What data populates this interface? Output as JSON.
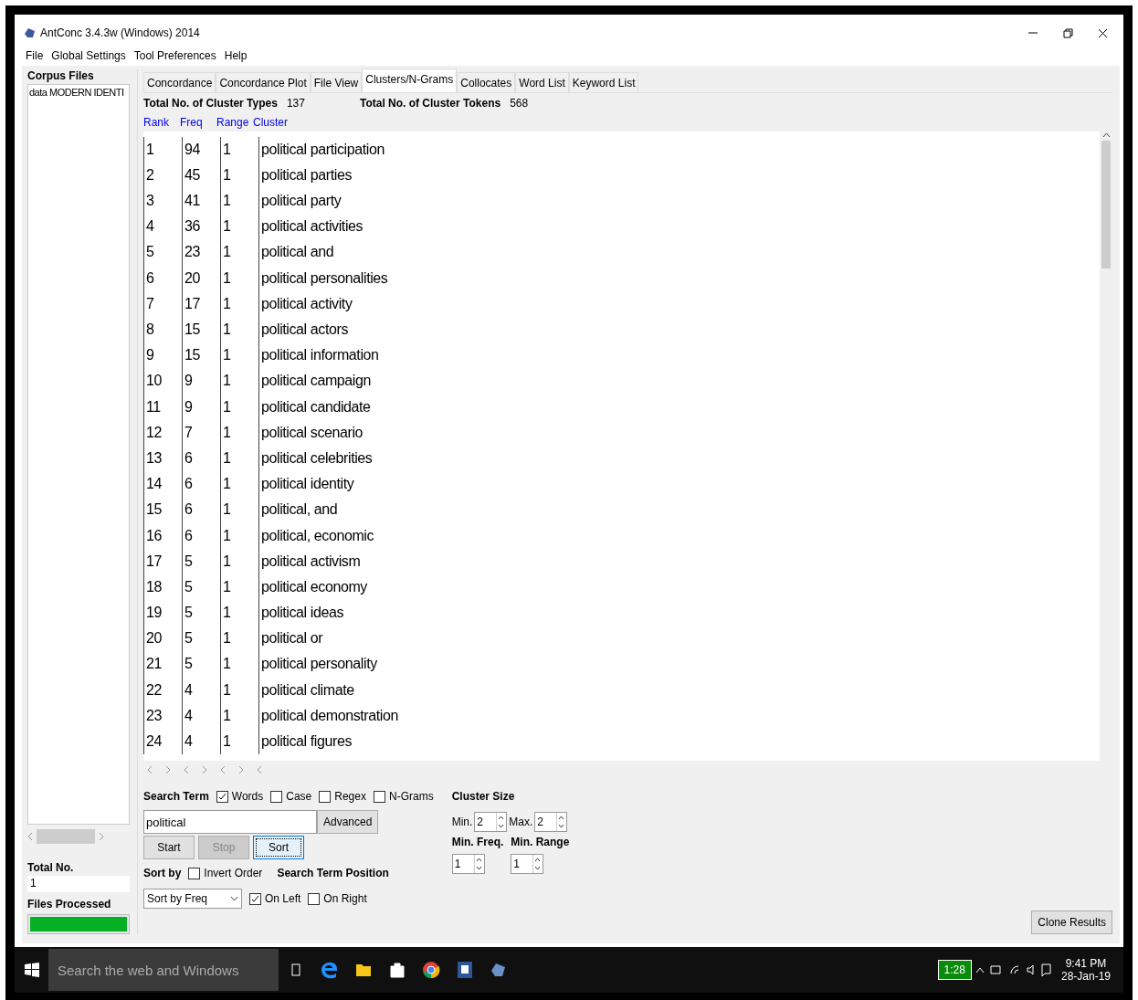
{
  "window": {
    "title": "AntConc 3.4.3w (Windows) 2014"
  },
  "menu": [
    "File",
    "Global Settings",
    "Tool Preferences",
    "Help"
  ],
  "sidebar": {
    "heading": "Corpus Files",
    "files": [
      "data MODERN IDENTI"
    ],
    "total_label": "Total No.",
    "total_value": "1",
    "processed_label": "Files Processed",
    "progress": {
      "level": 1
    }
  },
  "tabs": [
    {
      "label": "Concordance",
      "selected": false
    },
    {
      "label": "Concordance Plot",
      "selected": false
    },
    {
      "label": "File View",
      "selected": false
    },
    {
      "label": "Clusters/N-Grams",
      "selected": true
    },
    {
      "label": "Collocates",
      "selected": false
    },
    {
      "label": "Word List",
      "selected": false
    },
    {
      "label": "Keyword List",
      "selected": false
    }
  ],
  "totals": [
    {
      "label": "Total No. of Cluster Types",
      "value": "137"
    },
    {
      "label": "Total No. of Cluster Tokens",
      "value": "568"
    }
  ],
  "table": {
    "columns": [
      "Rank",
      "Freq",
      "Range",
      "Cluster"
    ],
    "rows": [
      [
        "1",
        "94",
        "1",
        "political participation"
      ],
      [
        "2",
        "45",
        "1",
        "political parties"
      ],
      [
        "3",
        "41",
        "1",
        "political party"
      ],
      [
        "4",
        "36",
        "1",
        "political activities"
      ],
      [
        "5",
        "23",
        "1",
        "political and"
      ],
      [
        "6",
        "20",
        "1",
        "political personalities"
      ],
      [
        "7",
        "17",
        "1",
        "political activity"
      ],
      [
        "8",
        "15",
        "1",
        "political actors"
      ],
      [
        "9",
        "15",
        "1",
        "political information"
      ],
      [
        "10",
        "9",
        "1",
        "political campaign"
      ],
      [
        "11",
        "9",
        "1",
        "political candidate"
      ],
      [
        "12",
        "7",
        "1",
        "political scenario"
      ],
      [
        "13",
        "6",
        "1",
        "political celebrities"
      ],
      [
        "14",
        "6",
        "1",
        "political identity"
      ],
      [
        "15",
        "6",
        "1",
        "political, and"
      ],
      [
        "16",
        "6",
        "1",
        "political, economic"
      ],
      [
        "17",
        "5",
        "1",
        "political activism"
      ],
      [
        "18",
        "5",
        "1",
        "political economy"
      ],
      [
        "19",
        "5",
        "1",
        "political ideas"
      ],
      [
        "20",
        "5",
        "1",
        "political or"
      ],
      [
        "21",
        "5",
        "1",
        "political personality"
      ],
      [
        "22",
        "4",
        "1",
        "political climate"
      ],
      [
        "23",
        "4",
        "1",
        "political demonstration"
      ],
      [
        "24",
        "4",
        "1",
        "political figures"
      ]
    ]
  },
  "search": {
    "label": "Search Term",
    "options": [
      {
        "label": "Words",
        "checked": true
      },
      {
        "label": "Case",
        "checked": false
      },
      {
        "label": "Regex",
        "checked": false
      },
      {
        "label": "N-Grams",
        "checked": false
      }
    ],
    "value": "political",
    "advanced": "Advanced"
  },
  "actions": [
    {
      "label": "Start",
      "disabled": false,
      "focused": false
    },
    {
      "label": "Stop",
      "disabled": true,
      "focused": false
    },
    {
      "label": "Sort",
      "disabled": false,
      "focused": true
    }
  ],
  "sort": {
    "label": "Sort by",
    "invert": {
      "label": "Invert Order",
      "checked": false
    },
    "value": "Sort by Freq"
  },
  "position": {
    "label": "Search Term Position",
    "options": [
      {
        "label": "On Left",
        "checked": true
      },
      {
        "label": "On Right",
        "checked": false
      }
    ]
  },
  "cluster_size": {
    "label": "Cluster Size",
    "min_label": "Min.",
    "min": "2",
    "max_label": "Max.",
    "max": "2"
  },
  "limits": [
    {
      "label": "Min. Freq.",
      "value": "1"
    },
    {
      "label": "Min. Range",
      "value": "1"
    }
  ],
  "clone": "Clone Results",
  "taskbar": {
    "search_placeholder": "Search the web and Windows",
    "battery": "1:28",
    "time": "9:41 PM",
    "date": "28-Jan-19"
  }
}
